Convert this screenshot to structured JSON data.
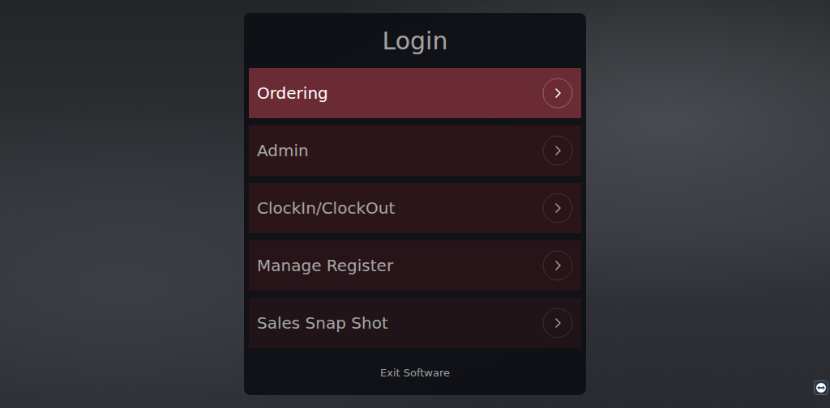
{
  "login": {
    "title": "Login",
    "items": [
      {
        "label": "Ordering",
        "selected": true
      },
      {
        "label": "Admin",
        "selected": false
      },
      {
        "label": "ClockIn/ClockOut",
        "selected": false
      },
      {
        "label": "Manage Register",
        "selected": false
      },
      {
        "label": "Sales Snap Shot",
        "selected": false
      }
    ],
    "exit": "Exit Software"
  }
}
